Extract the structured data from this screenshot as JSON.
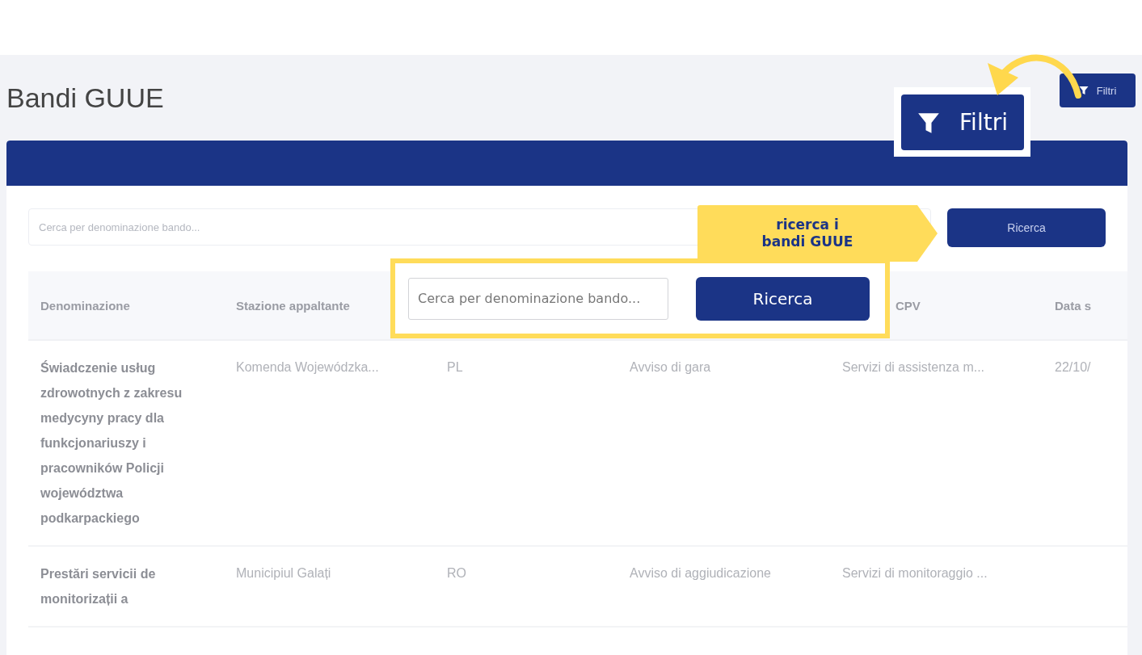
{
  "page": {
    "title": "Bandi GUUE",
    "filter_button": "Filtri"
  },
  "search": {
    "placeholder": "Cerca per denominazione bando...",
    "button": "Ricerca"
  },
  "table": {
    "columns": [
      {
        "label": "Denominazione"
      },
      {
        "label": "Stazione appaltante"
      },
      {},
      {},
      {
        "label": "CPV"
      },
      {
        "label": "Data s"
      }
    ],
    "rows": [
      [
        "Świadczenie usług zdrowotnych z zakresu medycyny pracy dla funkcjonariuszy i pracowników Policji województwa podkarpackiego",
        "Komenda Wojewódzka...",
        "PL",
        "Avviso di gara",
        "Servizi di assistenza m...",
        "22/10/"
      ],
      [
        "Prestări servicii de monitorizații a",
        "Municipiul Galați",
        "RO",
        "Avviso di aggiudicazione",
        "Servizi di monitoraggio ..."
      ]
    ]
  },
  "annotations": {
    "zoomed_filter_button": "Filtri",
    "label": "ricerca i\nbandi GUUE",
    "zoomed_search": {
      "placeholder": "Cerca per denominazione bando...",
      "button": "Ricerca"
    }
  }
}
